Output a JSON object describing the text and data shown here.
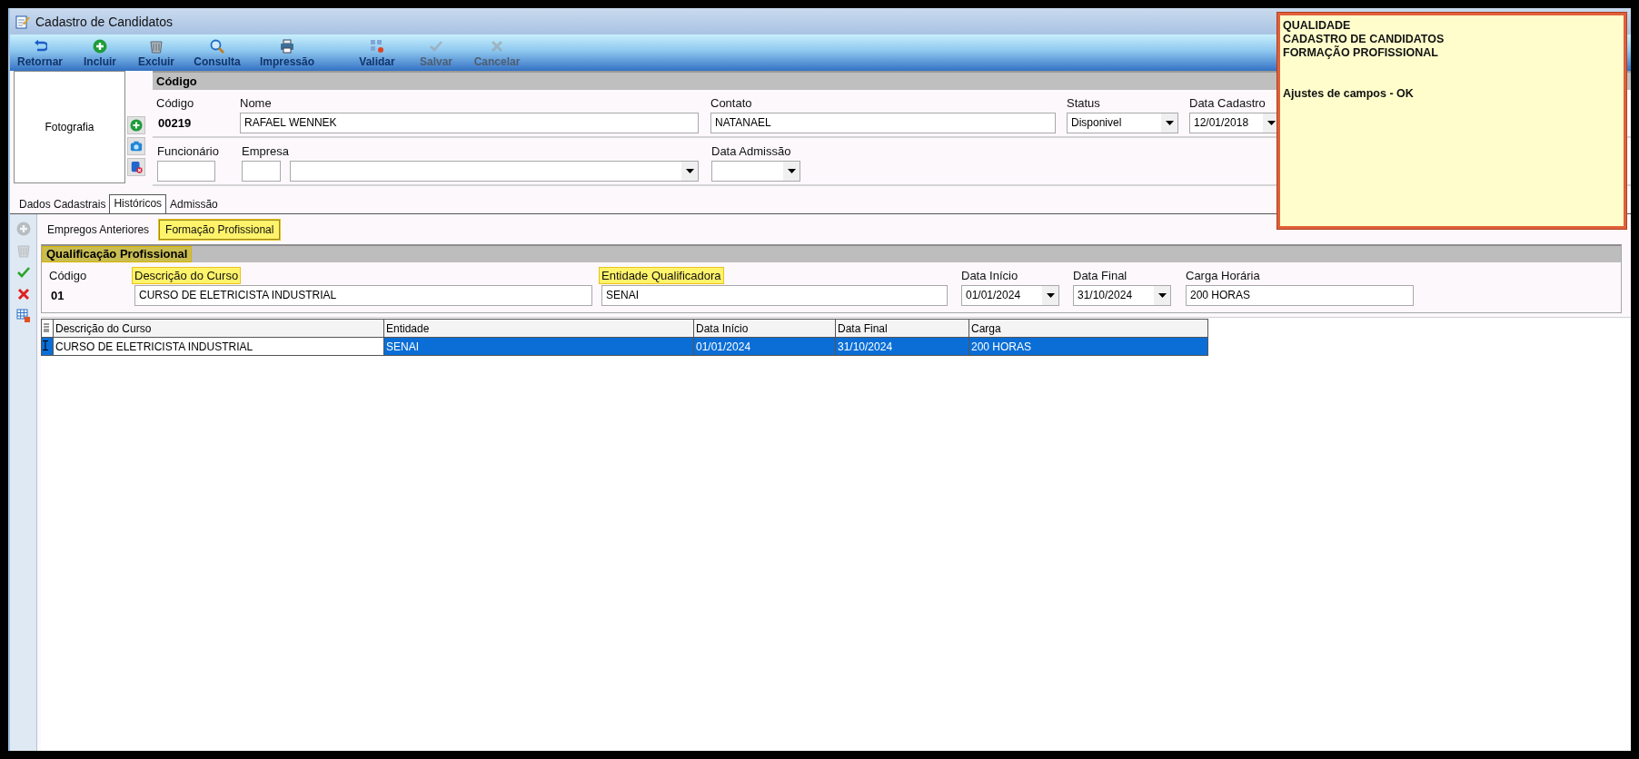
{
  "window": {
    "title": "Cadastro de Candidatos"
  },
  "toolbar": [
    {
      "label": "Retornar",
      "kind": "back",
      "disabled": false
    },
    {
      "label": "Incluir",
      "kind": "add",
      "disabled": false
    },
    {
      "label": "Excluir",
      "kind": "trash",
      "disabled": false
    },
    {
      "label": "Consulta",
      "kind": "search",
      "disabled": false
    },
    {
      "label": "Impressão",
      "kind": "print",
      "disabled": false
    },
    {
      "label": "Validar",
      "kind": "validate",
      "disabled": false
    },
    {
      "label": "Salvar",
      "kind": "check",
      "disabled": true
    },
    {
      "label": "Cancelar",
      "kind": "cancel",
      "disabled": true
    }
  ],
  "photo": {
    "label": "Fotografia"
  },
  "photo_tools": [
    {
      "kind": "add"
    },
    {
      "kind": "camera"
    },
    {
      "kind": "remove"
    }
  ],
  "header": {
    "title": "Código",
    "fields": [
      {
        "label": "Código",
        "value": "00219",
        "kind": "static"
      },
      {
        "label": "Nome",
        "value": "RAFAEL WENNEK",
        "kind": "text"
      },
      {
        "label": "Contato",
        "value": "NATANAEL",
        "kind": "text"
      },
      {
        "label": "Status",
        "value": "Disponivel",
        "kind": "combo"
      },
      {
        "label": "Data Cadastro",
        "value": "12/01/2018",
        "kind": "combo"
      }
    ],
    "fields_2": [
      {
        "label": "Funcionário",
        "kind": "text"
      },
      {
        "label": "Empresa",
        "kind": "text"
      },
      {
        "kind": "combo"
      },
      {
        "label": "Data Admissão",
        "kind": "combo"
      }
    ]
  },
  "tabs": [
    {
      "label": "Dados Cadastrais",
      "selected": false
    },
    {
      "label": "Históricos",
      "selected": true
    },
    {
      "label": "Admissão",
      "selected": false
    }
  ],
  "side_tools": [
    {
      "kind": "add",
      "disabled": true
    },
    {
      "kind": "trash",
      "disabled": true
    },
    {
      "kind": "check",
      "disabled": false
    },
    {
      "kind": "cancel",
      "disabled": false
    },
    {
      "kind": "grid",
      "disabled": false
    }
  ],
  "subtabs": [
    {
      "label": "Empregos Anteriores",
      "selected": false,
      "highlighted": false
    },
    {
      "label": "Formação Profissional",
      "selected": true,
      "highlighted": true
    }
  ],
  "qualification": {
    "title": "Qualificação Profissional",
    "highlighted": true,
    "fields": [
      {
        "label": "Código",
        "value": "01",
        "kind": "static",
        "highlighted": false
      },
      {
        "label": "Descrição do Curso",
        "value": "CURSO DE ELETRICISTA INDUSTRIAL",
        "kind": "text",
        "highlighted": true
      },
      {
        "label": "Entidade Qualificadora",
        "value": "SENAI",
        "kind": "text",
        "highlighted": true
      },
      {
        "label": "Data Início",
        "value": "01/01/2024",
        "kind": "combo",
        "highlighted": false
      },
      {
        "label": "Data Final",
        "value": "31/10/2024",
        "kind": "combo",
        "highlighted": false
      },
      {
        "label": "Carga Horária",
        "value": "200 HORAS",
        "kind": "text",
        "highlighted": false
      }
    ]
  },
  "grid": {
    "columns": [
      "Descrição do Curso",
      "Entidade",
      "Data Início",
      "Data Final",
      "Carga"
    ],
    "rows": [
      {
        "selected": true,
        "cells": [
          {
            "text": "CURSO DE ELETRICISTA INDUSTRIAL",
            "focused": true
          },
          {
            "text": "SENAI",
            "focused": false
          },
          {
            "text": "01/01/2024",
            "focused": false
          },
          {
            "text": "31/10/2024",
            "focused": false
          },
          {
            "text": "200 HORAS",
            "focused": false
          }
        ]
      }
    ]
  },
  "note": {
    "lines": [
      "QUALIDADE",
      "CADASTRO DE CANDIDATOS",
      "FORMAÇÃO PROFISSIONAL"
    ],
    "message": "Ajustes de campos - OK"
  }
}
